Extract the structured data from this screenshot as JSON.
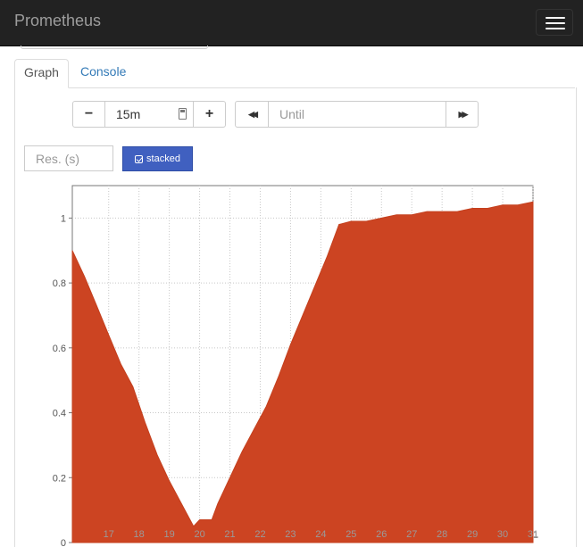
{
  "navbar": {
    "brand": "Prometheus"
  },
  "tabs": [
    {
      "label": "Graph",
      "active": true
    },
    {
      "label": "Console",
      "active": false
    }
  ],
  "controls": {
    "minus_label": "−",
    "range_value": "15m",
    "plus_label": "+",
    "back_label": "◀◀",
    "until_placeholder": "Until",
    "forward_label": "▶▶",
    "res_placeholder": "Res. (s)",
    "stacked_label": "stacked"
  },
  "colors": {
    "series": "#cc4422",
    "stacked_button": "#4060c0"
  },
  "chart_data": {
    "type": "area",
    "stacked": true,
    "title": "",
    "xlabel": "",
    "ylabel": "",
    "x_ticks": [
      "17",
      "18",
      "19",
      "20",
      "21",
      "22",
      "23",
      "24",
      "25",
      "26",
      "27",
      "28",
      "29",
      "30",
      "31"
    ],
    "y_ticks": [
      "0",
      "0.2",
      "0.4",
      "0.6",
      "0.8",
      "1"
    ],
    "ylim": [
      0,
      1.1
    ],
    "xlim": [
      15.8,
      31
    ],
    "grid": true,
    "series": [
      {
        "x": [
          15.8,
          16.2,
          16.6,
          17.0,
          17.4,
          17.8,
          18.2,
          18.6,
          19.0,
          19.4,
          19.8,
          20.0,
          20.2,
          20.4,
          20.6,
          21.0,
          21.4,
          21.8,
          22.2,
          22.6,
          23.0,
          23.4,
          23.8,
          24.2,
          24.6,
          25.0,
          25.5,
          26.0,
          26.5,
          27.0,
          27.5,
          28.0,
          28.5,
          29.0,
          29.5,
          30.0,
          30.5,
          31.0
        ],
        "y": [
          0.9,
          0.82,
          0.73,
          0.64,
          0.55,
          0.48,
          0.37,
          0.27,
          0.19,
          0.12,
          0.05,
          0.07,
          0.07,
          0.07,
          0.12,
          0.2,
          0.28,
          0.35,
          0.42,
          0.51,
          0.61,
          0.7,
          0.79,
          0.88,
          0.98,
          0.99,
          0.99,
          1.0,
          1.01,
          1.01,
          1.02,
          1.02,
          1.02,
          1.03,
          1.03,
          1.04,
          1.04,
          1.05
        ]
      }
    ]
  }
}
